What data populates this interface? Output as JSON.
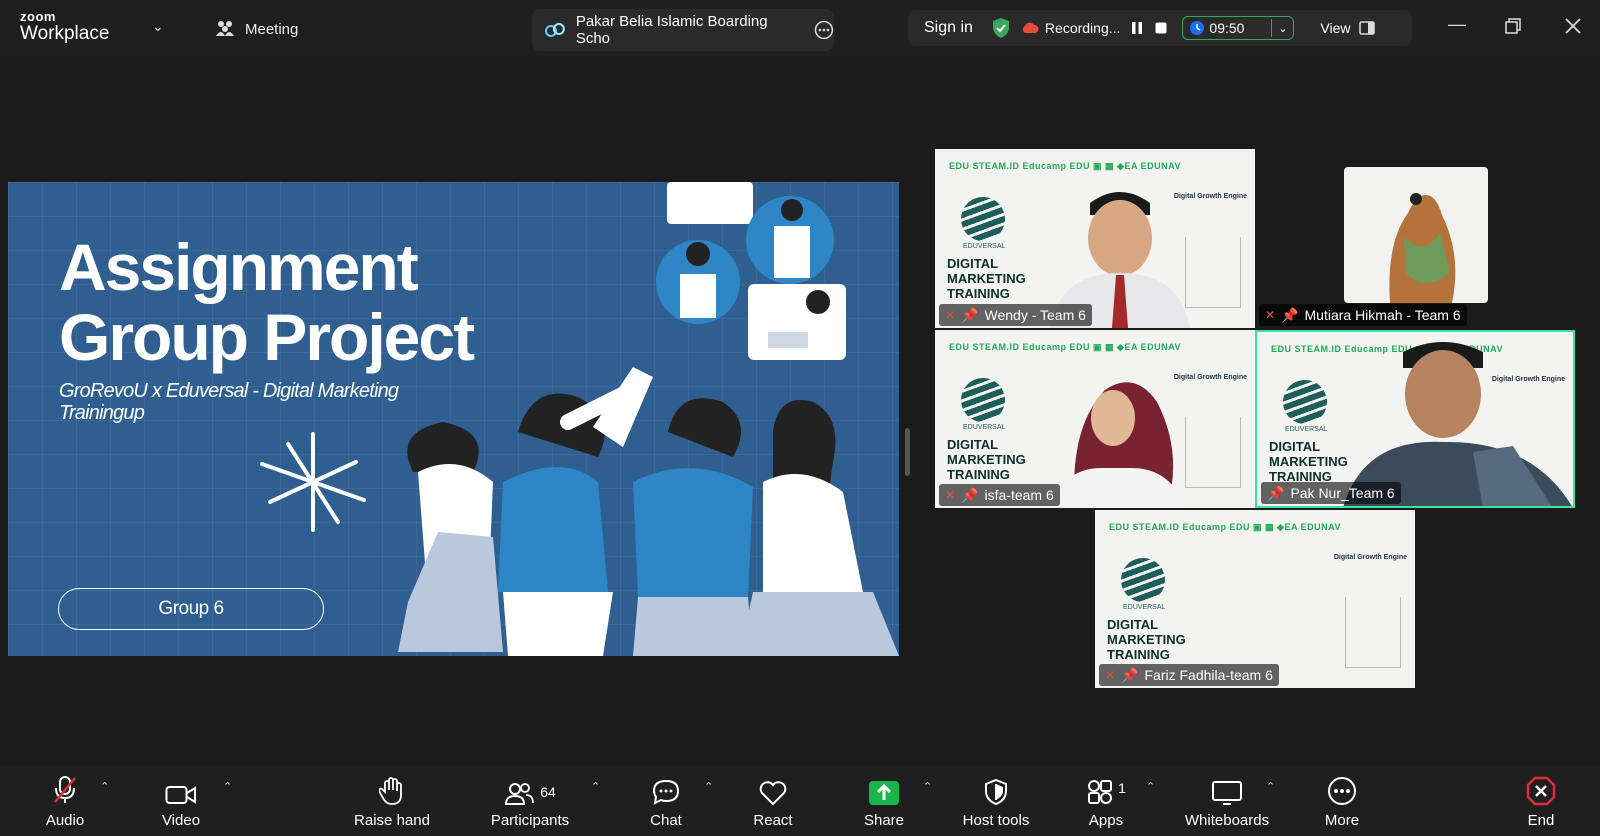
{
  "app": {
    "brand_small": "zoom",
    "brand_large": "Workplace"
  },
  "header": {
    "meeting_label": "Meeting",
    "meeting_title": "Pakar Belia Islamic Boarding Scho",
    "sign_in": "Sign in",
    "recording_label": "Recording...",
    "timer": "09:50",
    "view_label": "View"
  },
  "slide": {
    "title": "Assignment Group Project",
    "subtitle": "GroRevoU x Eduversal - Digital Marketing Trainingup",
    "group_label": "Group 6"
  },
  "tile_background": {
    "logo_row": "EDU STEAM.ID   Educamp   EDU   ▣   ▦   ◆EA   EDUNAV",
    "headline": "DIGITAL MARKETING TRAINING",
    "brand": "EDUVERSAL",
    "subhead": "Digital Growth Engine"
  },
  "participants": [
    {
      "name": "Wendy - Team 6",
      "muted": true
    },
    {
      "name": "Mutiara Hikmah - Team 6",
      "muted": true
    },
    {
      "name": "isfa-team 6",
      "muted": true
    },
    {
      "name": "Pak Nur_Team 6",
      "muted": false,
      "active_speaker": true
    },
    {
      "name": "Fariz Fadhila-team 6",
      "muted": true
    }
  ],
  "toolbar": {
    "audio": "Audio",
    "video": "Video",
    "raise_hand": "Raise hand",
    "participants": "Participants",
    "participants_count": "64",
    "chat": "Chat",
    "react": "React",
    "share": "Share",
    "host_tools": "Host tools",
    "apps": "Apps",
    "apps_count": "1",
    "whiteboards": "Whiteboards",
    "more": "More",
    "end": "End"
  },
  "colors": {
    "accent_green": "#3ba55c",
    "share_green": "#19b44b",
    "end_red": "#e02d3c",
    "slide_blue": "#2f5f90",
    "timer_blue": "#1a6ff2"
  }
}
